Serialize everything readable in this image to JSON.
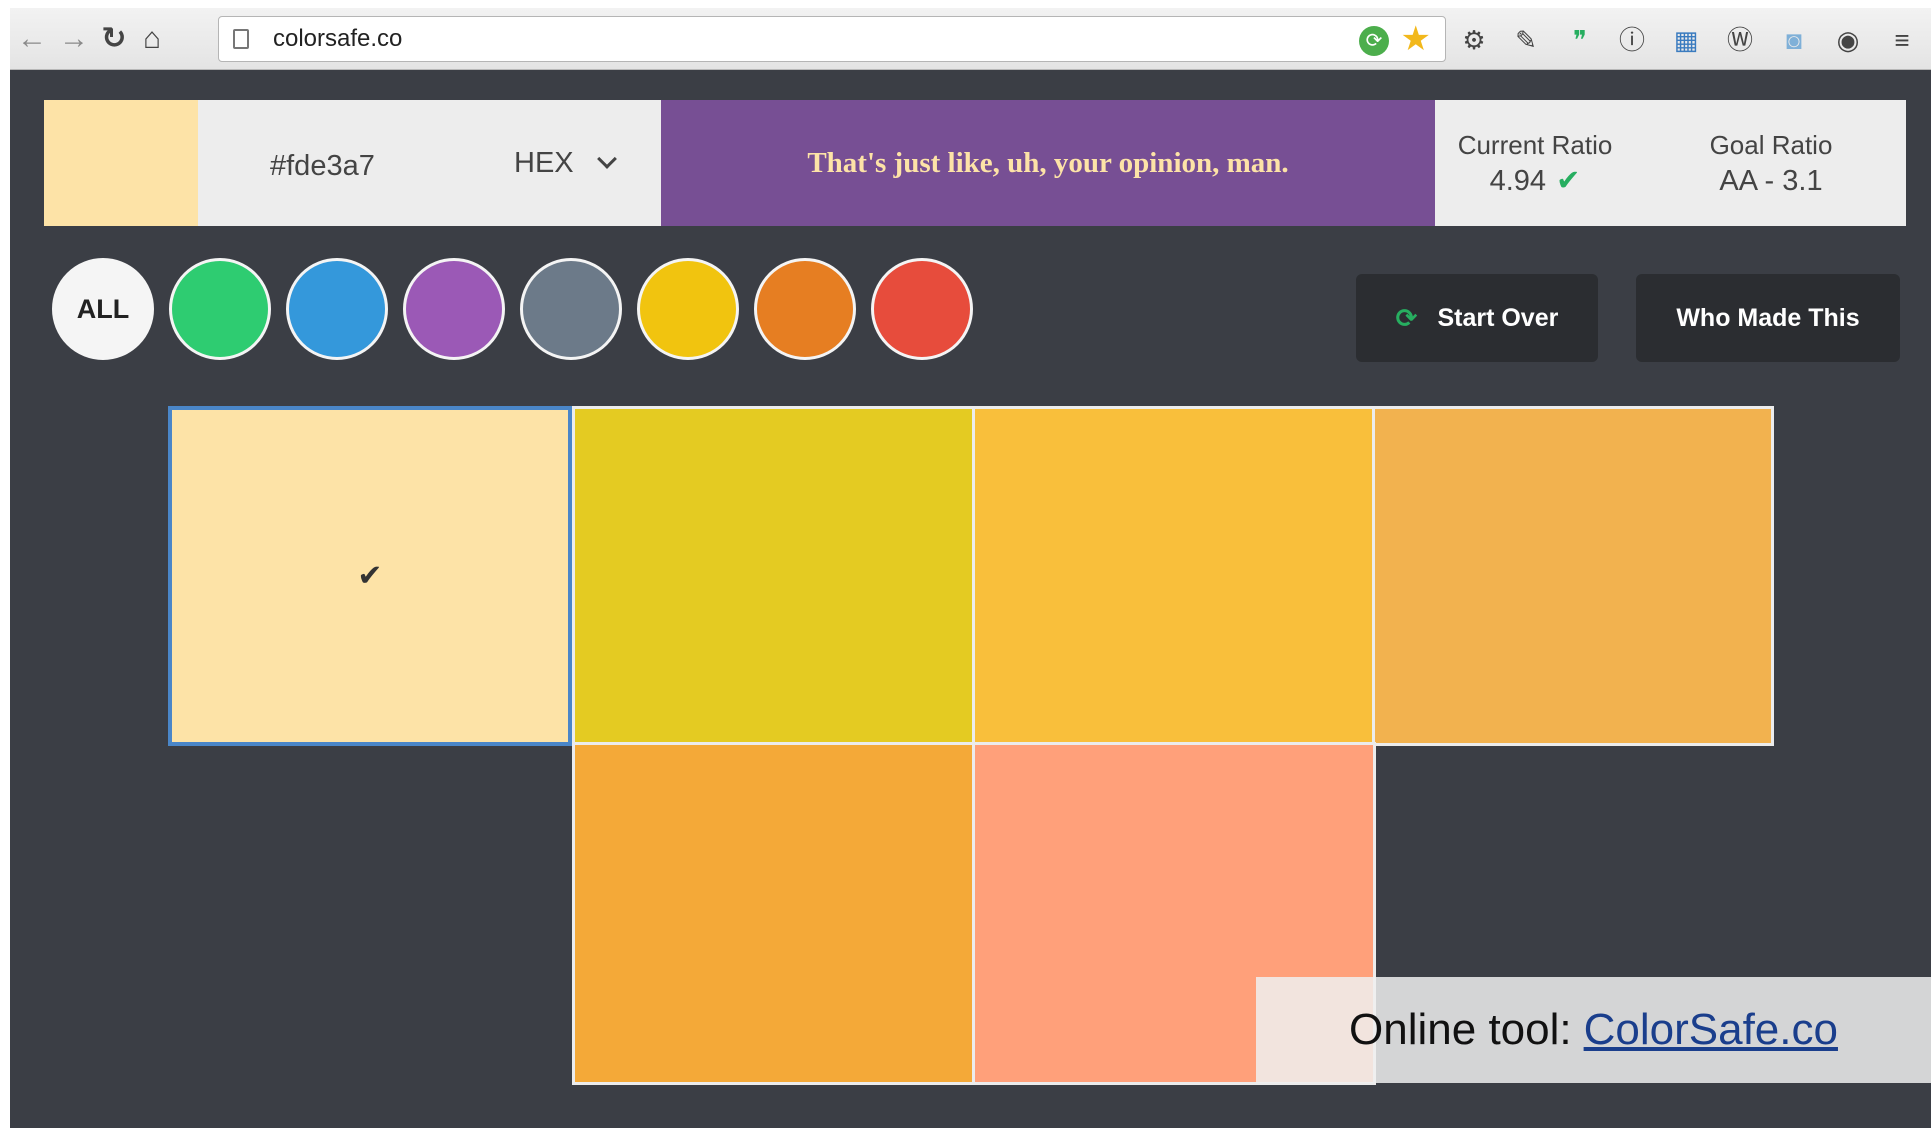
{
  "browser": {
    "url": "colorsafe.co",
    "back_icon": "←",
    "forward_icon": "→",
    "reload_icon": "↻",
    "home_icon": "⌂",
    "star_icon": "★",
    "menu_icon": "≡"
  },
  "app": {
    "selected_color": "#fde3a7",
    "hex_value": "#fde3a7",
    "format": "HEX",
    "sample_text": "That's just like, uh, your opinion, man.",
    "sample_bg": "#774f94",
    "current_ratio_label": "Current Ratio",
    "current_ratio_value": "4.94",
    "goal_ratio_label": "Goal Ratio",
    "goal_ratio_value": "AA - 3.1",
    "all_label": "ALL",
    "filter_colors": [
      "#2ecc71",
      "#3498db",
      "#9b59b6",
      "#6c7a89",
      "#f1c40f",
      "#e67e22",
      "#e74c3c"
    ],
    "start_over_label": "Start Over",
    "who_made_label": "Who Made This",
    "check_mark": "✔"
  },
  "swatches": [
    {
      "color": "#fde3a7",
      "selected": true
    },
    {
      "color": "#e4cb22",
      "selected": false
    },
    {
      "color": "#f9bf3b",
      "selected": false
    },
    {
      "color": "#f2b24f",
      "selected": false
    },
    {
      "color": "#f4a938",
      "selected": false
    },
    {
      "color": "#ffa07a",
      "selected": false
    }
  ],
  "caption": {
    "prefix": "Online tool:",
    "link": "ColorSafe.co"
  }
}
